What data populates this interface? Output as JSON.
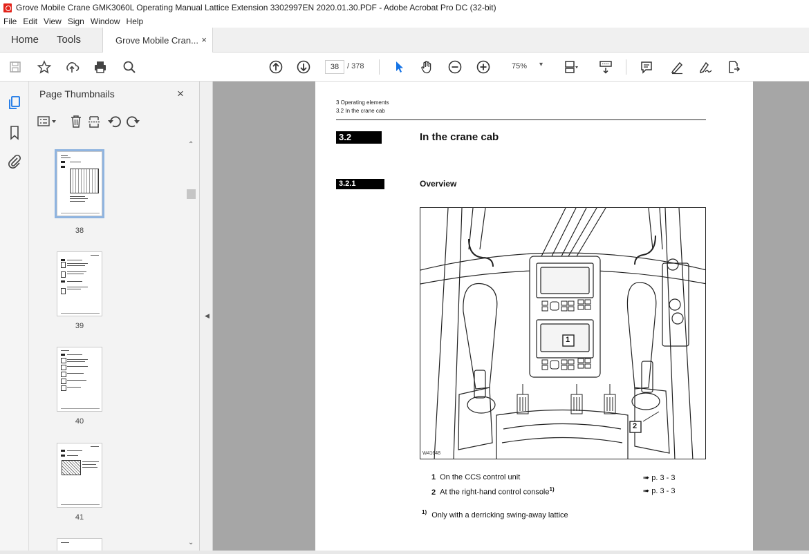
{
  "window": {
    "title": "Grove Mobile Crane GMK3060L Operating Manual Lattice Extension 3302997EN 2020.01.30.PDF - Adobe Acrobat Pro DC (32-bit)"
  },
  "menu": [
    "File",
    "Edit",
    "View",
    "Sign",
    "Window",
    "Help"
  ],
  "tabs": {
    "home": "Home",
    "tools": "Tools",
    "document": "Grove Mobile Cran...",
    "close": "×"
  },
  "toolbar": {
    "page_current": "38",
    "page_total": "/ 378",
    "zoom": "75%",
    "icons": [
      "save-icon",
      "bookmark-star-icon",
      "upload-icon",
      "print-icon",
      "find-icon",
      "prev-page-icon",
      "next-page-icon",
      "select-icon",
      "hand-icon",
      "zoom-out-icon",
      "zoom-in-icon",
      "fit-page-icon",
      "scroll-mode-icon",
      "comment-icon",
      "highlight-icon",
      "sign-icon",
      "share-icon"
    ]
  },
  "thumbnails": {
    "title": "Page Thumbnails",
    "close": "×",
    "pages": [
      {
        "label": "38",
        "selected": true
      },
      {
        "label": "39",
        "selected": false
      },
      {
        "label": "40",
        "selected": false
      },
      {
        "label": "41",
        "selected": false
      }
    ]
  },
  "document": {
    "header_chapter": "3 Operating elements",
    "header_section": "3.2 In the crane cab",
    "section_number": "3.2",
    "section_title": "In the crane cab",
    "subsection_number": "3.2.1",
    "subsection_title": "Overview",
    "figure_code": "W41648",
    "callout_1": "1",
    "callout_2": "2",
    "legend": [
      {
        "num": "1",
        "text": "On the CCS control unit",
        "ref": "➠ p. 3 - 3"
      },
      {
        "num": "2",
        "text": "At the right-hand control console",
        "sup": "1)",
        "ref": "➠ p. 3 - 3"
      }
    ],
    "footnote_mark": "1)",
    "footnote_text": "Only with a derricking swing-away lattice"
  }
}
